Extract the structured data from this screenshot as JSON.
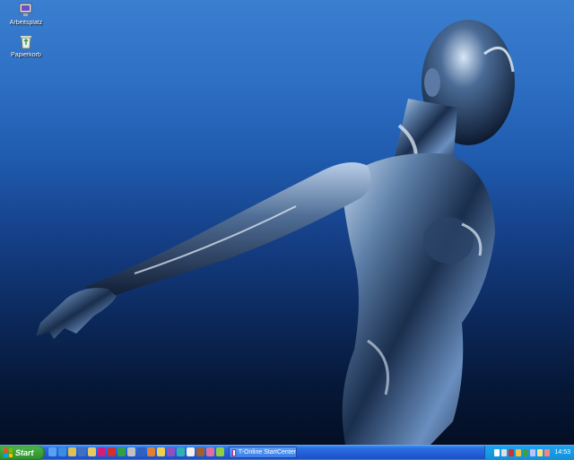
{
  "desktop": {
    "icons": [
      {
        "label": "Arbeitsplatz",
        "icon": "monitor-icon"
      },
      {
        "label": "Papierkorb",
        "icon": "recycle-bin-icon"
      }
    ],
    "wallpaper": "chrome-figure-wallpaper"
  },
  "taskbar": {
    "start_label": "Start",
    "quick_launch": [
      {
        "icon": "show-desktop-icon",
        "color": "#5aa0f0"
      },
      {
        "icon": "internet-explorer-icon",
        "color": "#3a8de0"
      },
      {
        "icon": "outlook-icon",
        "color": "#e0c050"
      },
      {
        "icon": "media-player-icon",
        "color": "#4070c0"
      },
      {
        "icon": "folder-icon",
        "color": "#e8c860"
      },
      {
        "icon": "t-online-icon",
        "color": "#d61c7a"
      },
      {
        "icon": "app-red-icon",
        "color": "#d03030"
      },
      {
        "icon": "app-green-icon",
        "color": "#30a040"
      },
      {
        "icon": "app-gray-icon",
        "color": "#c0c0c0"
      },
      {
        "icon": "app-blue-icon",
        "color": "#3060c0"
      },
      {
        "icon": "app-orange-icon",
        "color": "#e08030"
      },
      {
        "icon": "app-yellow-icon",
        "color": "#f0d050"
      },
      {
        "icon": "app-purple-icon",
        "color": "#9050c0"
      },
      {
        "icon": "app-teal-icon",
        "color": "#30b0b0"
      },
      {
        "icon": "app-white-icon",
        "color": "#f0f0f0"
      },
      {
        "icon": "app-brown-icon",
        "color": "#a06030"
      },
      {
        "icon": "app-pink-icon",
        "color": "#e070a0"
      },
      {
        "icon": "app-lime-icon",
        "color": "#90d040"
      }
    ],
    "task": {
      "label": "T-Online StartCenter",
      "icon": "t-online-window-icon"
    },
    "tray_icons": [
      {
        "icon": "volume-icon",
        "color": "#ffffff"
      },
      {
        "icon": "network-icon",
        "color": "#e0e0e0"
      },
      {
        "icon": "antivirus-icon",
        "color": "#d03030"
      },
      {
        "icon": "security-icon",
        "color": "#f0c040"
      },
      {
        "icon": "update-icon",
        "color": "#40a040"
      },
      {
        "icon": "tray-app-icon",
        "color": "#c0c0ff"
      },
      {
        "icon": "tray-app2-icon",
        "color": "#ffe080"
      },
      {
        "icon": "tray-app3-icon",
        "color": "#ff8080"
      }
    ],
    "clock": "14:53"
  }
}
